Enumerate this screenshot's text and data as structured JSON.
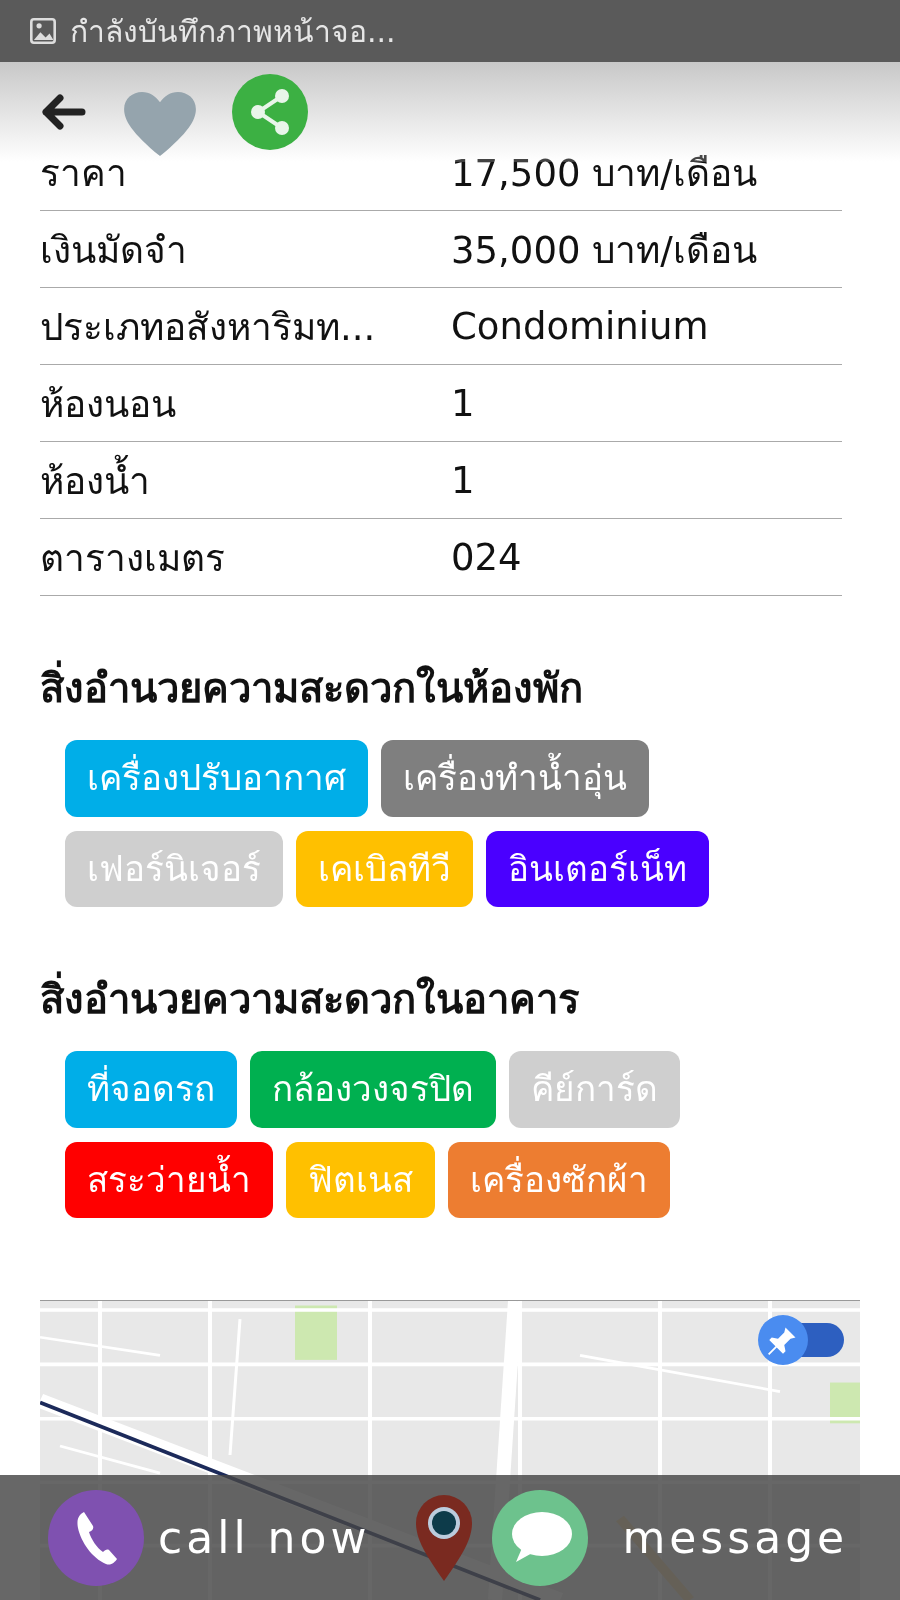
{
  "status_bar": {
    "notification": "กำลังบันทึกภาพหน้าจอ..."
  },
  "header": {
    "favorite": false
  },
  "details": [
    {
      "label": "ราคา",
      "value": "17,500 บาท/เดือน"
    },
    {
      "label": "เงินมัดจำ",
      "value": "35,000 บาท/เดือน"
    },
    {
      "label": "ประเภทอสังหาริมท...",
      "value": "Condominium"
    },
    {
      "label": "ห้องนอน",
      "value": "1"
    },
    {
      "label": "ห้องน้ำ",
      "value": "1"
    },
    {
      "label": "ตารางเมตร",
      "value": "024"
    }
  ],
  "amenity_sections": [
    {
      "title": "สิ่งอำนวยความสะดวกในห้องพัก",
      "tags": [
        {
          "label": "เครื่องปรับอากาศ",
          "color": "#00aee8"
        },
        {
          "label": "เครื่องทำน้ำอุ่น",
          "color": "#7f7f7f"
        },
        {
          "label": "เฟอร์นิเจอร์",
          "color": "#cfcfcf"
        },
        {
          "label": "เคเบิลทีวี",
          "color": "#ffc000"
        },
        {
          "label": "อินเตอร์เน็ท",
          "color": "#4a00ff"
        }
      ]
    },
    {
      "title": "สิ่งอำนวยความสะดวกในอาคาร",
      "tags": [
        {
          "label": "ที่จอดรถ",
          "color": "#00aee8"
        },
        {
          "label": "กล้องวงจรปิด",
          "color": "#00b050"
        },
        {
          "label": "คีย์การ์ด",
          "color": "#cfcfcf"
        },
        {
          "label": "สระว่ายน้ำ",
          "color": "#ff0000"
        },
        {
          "label": "ฟิตเนส",
          "color": "#ffc000"
        },
        {
          "label": "เครื่องซักผ้า",
          "color": "#ed7d31"
        }
      ]
    }
  ],
  "map": {
    "kind": "picture",
    "pin_toggle": {
      "on": true
    }
  },
  "action_bar": {
    "call_label": "call now",
    "message_label": "message"
  }
}
